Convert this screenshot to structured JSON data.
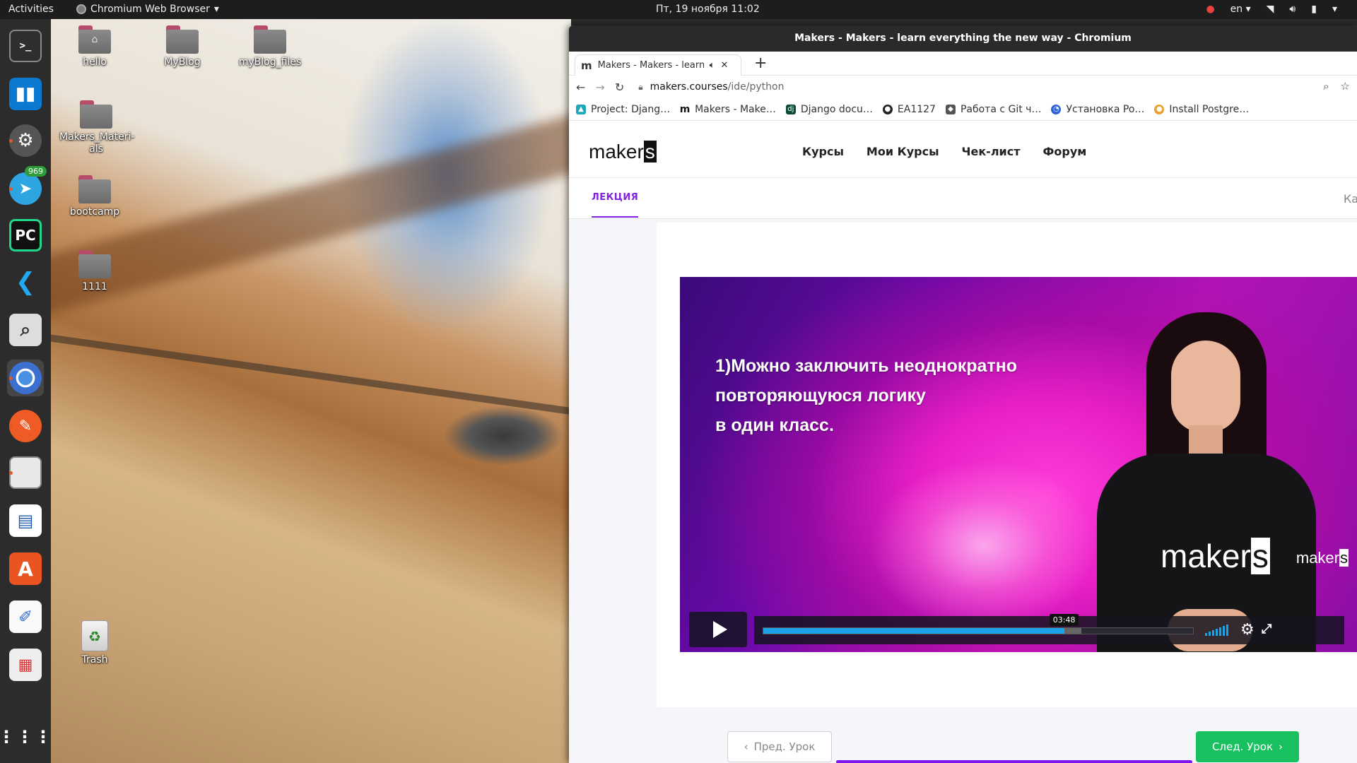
{
  "topbar": {
    "activities": "Activities",
    "app_menu": "Chromium Web Browser",
    "clock": "Пт, 19 ноября  11:02",
    "lang": "en"
  },
  "desktop": {
    "items": [
      {
        "label": "hello"
      },
      {
        "label": "MyBlog"
      },
      {
        "label": "myBlog_files"
      },
      {
        "label": "Makers_Materi-als"
      },
      {
        "label": "bootcamp"
      },
      {
        "label": "1111"
      },
      {
        "label": "Trash"
      }
    ]
  },
  "dock": {
    "telegram_badge": "969",
    "pycharm_label": "PC"
  },
  "browser": {
    "window_title": "Makers - Makers - learn everything the new way - Chromium",
    "tab_title": "Makers - Makers - learn everything",
    "tab_favicon": "m",
    "url_host": "makers.courses",
    "url_path": "/ide/python",
    "bookmarks": [
      {
        "label": "Project: Djang…",
        "color": "#1ea7b8"
      },
      {
        "label": "Makers - Make…",
        "color": "#ffffff"
      },
      {
        "label": "Django docu…",
        "color": "#0c4b33"
      },
      {
        "label": "EA1127",
        "color": "#222222"
      },
      {
        "label": "Работа с Git ч…",
        "color": "#555555"
      },
      {
        "label": "Установка Po…",
        "color": "#2f62d8"
      },
      {
        "label": "Install Postgre…",
        "color": "#e8a030"
      }
    ]
  },
  "site": {
    "logo_text": "maker",
    "logo_last": "s",
    "nav": [
      "Курсы",
      "Мои Курсы",
      "Чек-лист",
      "Форум"
    ],
    "lecture_tab": "ЛЕКЦИЯ",
    "right_tab_partial": "Ка"
  },
  "video": {
    "lines": [
      "1)Можно заключить неоднократно",
      "повторяющуюся логику",
      "в один класс."
    ],
    "shirt_text": "maker",
    "shirt_last": "s",
    "watermark_text": "maker",
    "watermark_last": "s",
    "time_tooltip": "03:48",
    "played_fraction": 0.7,
    "buffered_fraction": 0.74
  },
  "lesson_nav": {
    "prev_label": "Пред. Урок",
    "next_label": "След. Урок"
  },
  "colors": {
    "accent_purple": "#8222e0",
    "next_green": "#19c060",
    "progress_blue": "#1aa3e8"
  }
}
